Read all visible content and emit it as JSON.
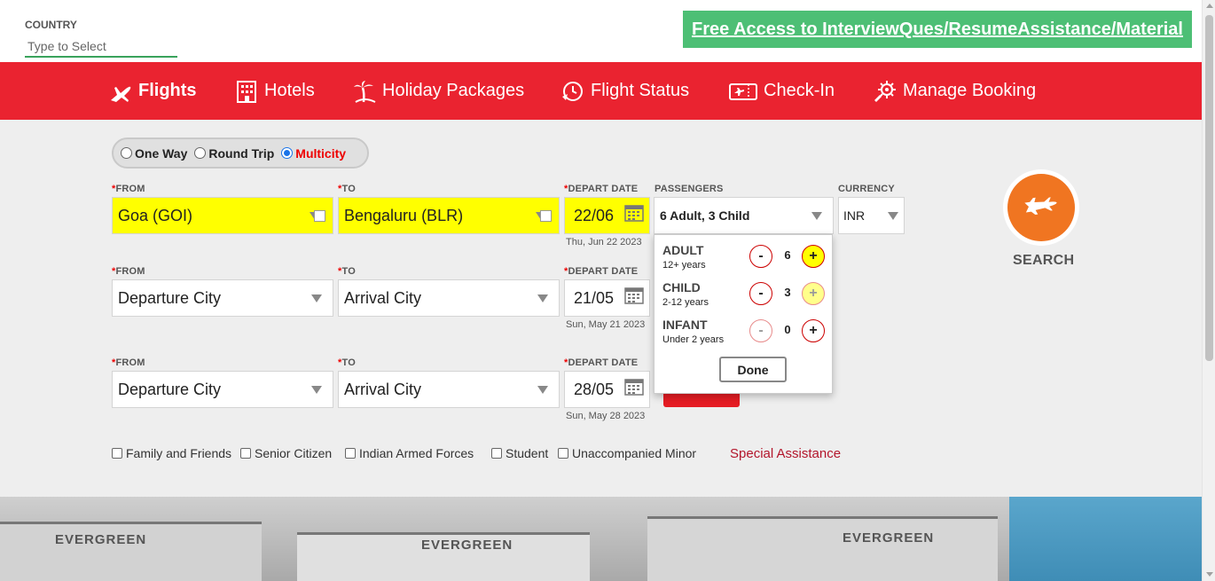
{
  "top": {
    "country_label": "COUNTRY",
    "country_placeholder": "Type to Select",
    "promo_link": "Free Access to InterviewQues/ResumeAssistance/Material"
  },
  "nav": {
    "items": [
      {
        "label": "Flights",
        "icon": "plane-icon",
        "active": true
      },
      {
        "label": "Hotels",
        "icon": "hotel-icon"
      },
      {
        "label": "Holiday Packages",
        "icon": "palm-tree-icon"
      },
      {
        "label": "Flight Status",
        "icon": "flight-status-icon"
      },
      {
        "label": "Check-In",
        "icon": "ticket-icon"
      },
      {
        "label": "Manage Booking",
        "icon": "gear-settings-icon"
      }
    ]
  },
  "trip_type": {
    "options": [
      "One Way",
      "Round Trip",
      "Multicity"
    ],
    "selected": "Multicity"
  },
  "labels": {
    "required_mark": "*",
    "from": "FROM",
    "to": "TO",
    "depart_date": "DEPART DATE",
    "passengers": "PASSENGERS",
    "currency": "CURRENCY"
  },
  "segments": [
    {
      "from": "Goa (GOI)",
      "to": "Bengaluru (BLR)",
      "date": "22/06",
      "date_full": "Thu, Jun 22 2023"
    },
    {
      "from": "Departure City",
      "to": "Arrival City",
      "date": "21/05",
      "date_full": "Sun, May 21 2023"
    },
    {
      "from": "Departure City",
      "to": "Arrival City",
      "date": "28/05",
      "date_full": "Sun, May 28 2023"
    }
  ],
  "passengers": {
    "summary": "6 Adult, 3 Child",
    "rows": [
      {
        "name": "ADULT",
        "age": "12+ years",
        "count": "6",
        "minus": "-",
        "plus": "+"
      },
      {
        "name": "CHILD",
        "age": "2-12 years",
        "count": "3",
        "minus": "-",
        "plus": "+"
      },
      {
        "name": "INFANT",
        "age": "Under 2 years",
        "count": "0",
        "minus": "-",
        "plus": "+"
      }
    ],
    "done_label": "Done"
  },
  "currency": {
    "value": "INR"
  },
  "search": {
    "label": "SEARCH"
  },
  "options": {
    "checkboxes": [
      "Family and Friends",
      "Senior Citizen",
      "Indian Armed Forces",
      "Student",
      "Unaccompanied Minor"
    ],
    "special_assistance": "Special Assistance"
  },
  "banner": {
    "hangar_texts": [
      "EVERGREEN",
      "EVERGREEN",
      "EVERGREEN"
    ]
  },
  "colors": {
    "nav_red": "#ea2330",
    "promo_green": "#4dbf75",
    "highlight_yellow": "#ffff00",
    "search_orange": "#f07521",
    "special_red": "#b3152b"
  }
}
